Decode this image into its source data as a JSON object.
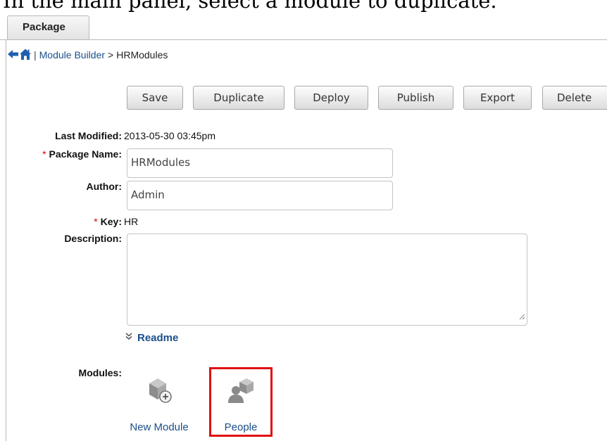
{
  "caption": "In the main panel, select a module to duplicate.",
  "tab": {
    "label": "Package"
  },
  "breadcrumb": {
    "separator": "|",
    "link": "Module Builder",
    "arrow": ">",
    "current": "HRModules",
    "back_icon": "back-arrow-icon",
    "home_icon": "home-icon"
  },
  "toolbar": {
    "save": "Save",
    "duplicate": "Duplicate",
    "deploy": "Deploy",
    "publish": "Publish",
    "export": "Export",
    "delete": "Delete"
  },
  "form": {
    "last_modified": {
      "label": "Last Modified:",
      "value": "2013-05-30 03:45pm"
    },
    "package_name": {
      "required": "*",
      "label": "Package Name:",
      "value": "HRModules"
    },
    "author": {
      "label": "Author:",
      "value": "Admin"
    },
    "key": {
      "required": "*",
      "label": "Key:",
      "value": "HR"
    },
    "description": {
      "label": "Description:",
      "value": ""
    }
  },
  "readme": {
    "label": "Readme",
    "icon": "double-chevron-down-icon"
  },
  "modules": {
    "label": "Modules:",
    "items": [
      {
        "label": "New Module",
        "icon": "new-module-icon"
      },
      {
        "label": "People",
        "icon": "people-module-icon",
        "highlighted": true
      }
    ]
  },
  "colors": {
    "link": "#1a4f8a",
    "required": "#dd0000",
    "highlight": "#e01010"
  }
}
